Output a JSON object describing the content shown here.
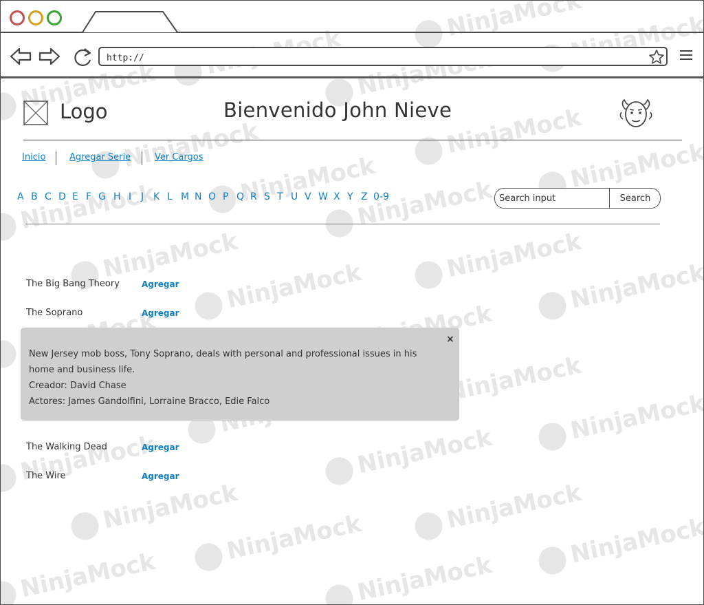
{
  "browser": {
    "url": "http://"
  },
  "header": {
    "logo_text": "Logo",
    "welcome": "Bienvenido John Nieve"
  },
  "nav": {
    "items": [
      {
        "label": "Inicio"
      },
      {
        "label": "Agregar Serie"
      },
      {
        "label": "Ver Cargos"
      }
    ]
  },
  "alphabet": [
    "A",
    "B",
    "C",
    "D",
    "E",
    "F",
    "G",
    "H",
    "I",
    "J",
    "K",
    "L",
    "M",
    "N",
    "O",
    "P",
    "Q",
    "R",
    "S",
    "T",
    "U",
    "V",
    "W",
    "X",
    "Y",
    "Z",
    "0-9"
  ],
  "search": {
    "placeholder": "Search input",
    "button_label": "Search"
  },
  "series": [
    {
      "name": "The Big Bang Theory",
      "action": "Agregar"
    },
    {
      "name": "The Soprano",
      "action": "Agregar"
    },
    {
      "name": "The Walking Dead",
      "action": "Agregar"
    },
    {
      "name": "The Wire",
      "action": "Agregar"
    }
  ],
  "popup": {
    "close": "×",
    "description_line1": "New Jersey mob boss, Tony Soprano, deals with personal and professional issues in his",
    "description_line2": "home and business life.",
    "creator": "Creador: David Chase",
    "actors": "Actores: James Gandolfini, Lorraine Bracco, Edie Falco"
  },
  "watermark": "NinjaMock"
}
